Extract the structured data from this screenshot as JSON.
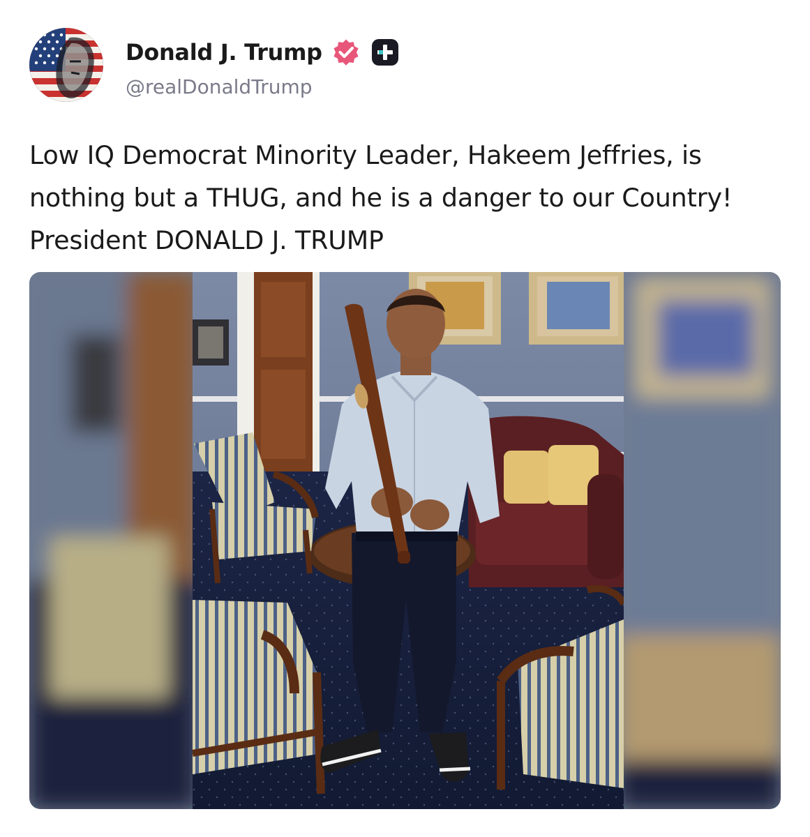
{
  "post": {
    "author": {
      "display_name": "Donald J. Trump",
      "handle": "@realDonaldTrump",
      "avatar_icon": "flag-portrait-avatar",
      "verified_icon": "verified-badge-icon",
      "verified_color": "#e8567a",
      "plus_icon": "plus-badge-icon",
      "plus_color": "#1a1a24"
    },
    "text": "Low IQ Democrat Minority Leader, Hakeem Jeffries, is nothing but a THUG, and he is a danger to our Country! President DONALD J. TRUMP",
    "media": {
      "type": "photo",
      "icon": "photo-man-holding-baseball-bat"
    }
  }
}
